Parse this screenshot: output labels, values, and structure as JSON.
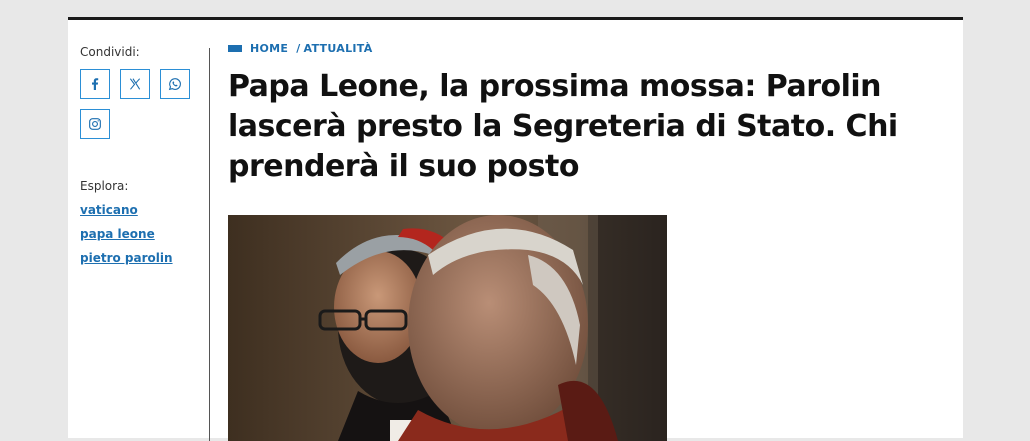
{
  "sidebar": {
    "share_label": "Condividi:",
    "share_buttons": [
      {
        "icon": "facebook-icon"
      },
      {
        "icon": "x-icon"
      },
      {
        "icon": "whatsapp-icon"
      },
      {
        "icon": "instagram-icon"
      }
    ],
    "explore_label": "Esplora:",
    "tags": [
      "vaticano",
      "papa leone",
      "pietro parolin"
    ]
  },
  "breadcrumb": {
    "home": "HOME",
    "separator": "/",
    "section": "ATTUALITÀ"
  },
  "article": {
    "title": "Papa Leone, la prossima mossa: Parolin lascerà presto la Segreteria di Stato. Chi prenderà il suo posto"
  },
  "colors": {
    "accent": "#1d6fb0",
    "border": "#2b8fd6",
    "title": "#111111"
  }
}
